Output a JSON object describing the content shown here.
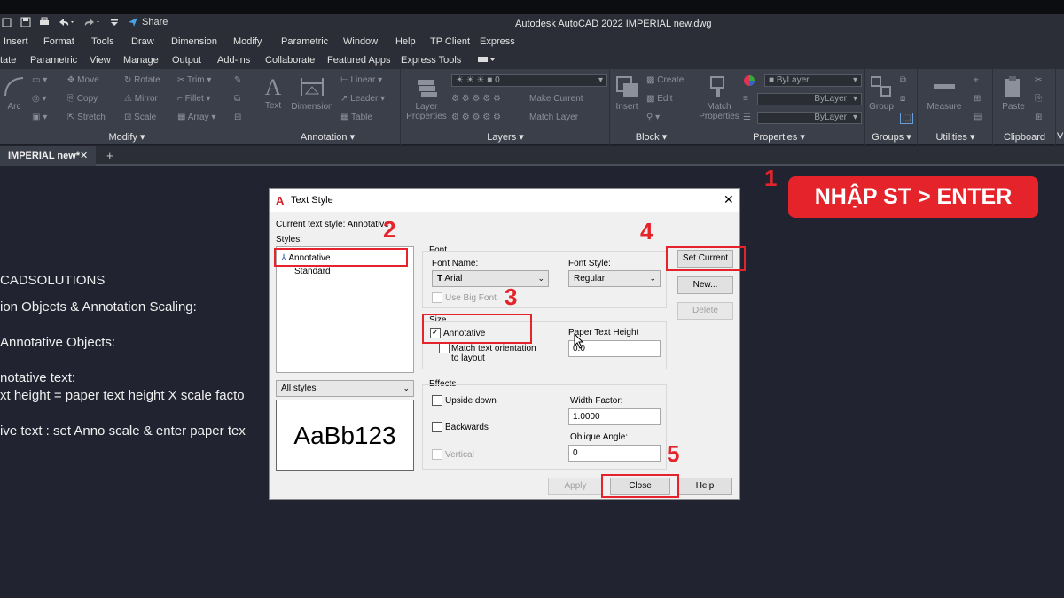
{
  "window": {
    "title": "Autodesk AutoCAD 2022   IMPERIAL new.dwg",
    "share_label": "Share"
  },
  "menu": [
    "Insert",
    "Format",
    "Tools",
    "Draw",
    "Dimension",
    "Modify",
    "Parametric",
    "Window",
    "Help",
    "TP Client",
    "Express"
  ],
  "ribbon_tabs": [
    "tate",
    "Parametric",
    "View",
    "Manage",
    "Output",
    "Add-ins",
    "Collaborate",
    "Featured Apps",
    "Express Tools"
  ],
  "ribbon": {
    "modify": {
      "title": "Modify",
      "arc": "Arc",
      "move": "Move",
      "rotate": "Rotate",
      "trim": "Trim",
      "copy": "Copy",
      "mirror": "Mirror",
      "fillet": "Fillet",
      "stretch": "Stretch",
      "scale": "Scale",
      "array": "Array"
    },
    "annotation": {
      "title": "Annotation",
      "text": "Text",
      "dimension": "Dimension",
      "linear": "Linear",
      "leader": "Leader",
      "table": "Table"
    },
    "layers": {
      "title": "Layers",
      "layer_properties": "Layer Properties",
      "layer_value": "0",
      "make_current": "Make Current",
      "match_layer": "Match Layer"
    },
    "block": {
      "title": "Block",
      "insert": "Insert",
      "create": "Create",
      "edit": "Edit"
    },
    "properties": {
      "title": "Properties",
      "match_properties": "Match Properties",
      "bylayer1": "ByLayer",
      "bylayer2": "ByLayer",
      "bylayer3": "ByLayer"
    },
    "groups": {
      "title": "Groups",
      "group": "Group"
    },
    "utilities": {
      "title": "Utilities",
      "measure": "Measure"
    },
    "clipboard": {
      "title": "Clipboard",
      "paste": "Paste"
    },
    "extra": "V"
  },
  "document_tab": {
    "label": "IMPERIAL new*",
    "close": "✕",
    "add": "+"
  },
  "canvas_lines": [
    "CADSOLUTIONS",
    "ion Objects & Annotation Scaling:",
    "Annotative Objects:",
    "notative text:",
    "xt height = paper text height X scale facto",
    "ive text : set Anno scale & enter paper tex"
  ],
  "dialog": {
    "title": "Text Style",
    "current_style_label": "Current text style:",
    "current_style_value": "Annotative",
    "styles_label": "Styles:",
    "styles": [
      "Annotative",
      "Standard"
    ],
    "filter": "All styles",
    "preview_text": "AaBb123",
    "font_group": "Font",
    "font_name_label": "Font Name:",
    "font_name_value": "Arial",
    "font_style_label": "Font Style:",
    "font_style_value": "Regular",
    "use_big_font": "Use Big Font",
    "size_group": "Size",
    "annotative_label": "Annotative",
    "match_orientation": "Match text orientation to layout",
    "paper_height_label": "Paper Text Height",
    "paper_height_value": "0.0",
    "effects_group": "Effects",
    "upside_down": "Upside down",
    "backwards": "Backwards",
    "vertical": "Vertical",
    "width_factor_label": "Width Factor:",
    "width_factor_value": "1.0000",
    "oblique_label": "Oblique Angle:",
    "oblique_value": "0",
    "set_current": "Set Current",
    "new": "New...",
    "delete": "Delete",
    "apply": "Apply",
    "close": "Close",
    "help": "Help",
    "annotative_checked": true
  },
  "annotations": {
    "banner": "NHẬP ST > ENTER",
    "steps": [
      "1",
      "2",
      "3",
      "4",
      "5"
    ],
    "accent_color": "#e5232b"
  }
}
